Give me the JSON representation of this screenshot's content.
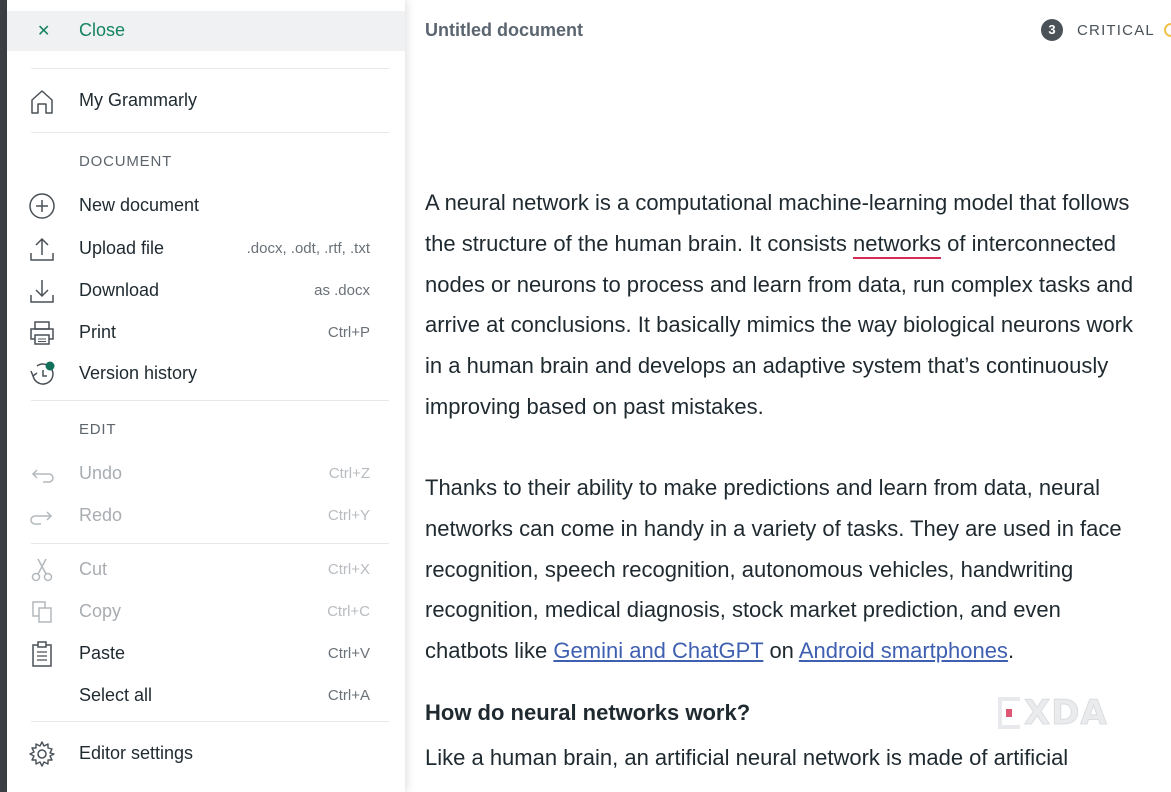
{
  "menu": {
    "close_label": "Close",
    "home_label": "My Grammarly",
    "section_document": "DOCUMENT",
    "document_items": [
      {
        "label": "New document",
        "hint": "",
        "icon": "plus-circle-icon"
      },
      {
        "label": "Upload file",
        "hint": ".docx, .odt, .rtf, .txt",
        "icon": "upload-icon"
      },
      {
        "label": "Download",
        "hint": "as .docx",
        "icon": "download-icon"
      },
      {
        "label": "Print",
        "hint": "Ctrl+P",
        "icon": "printer-icon"
      },
      {
        "label": "Version history",
        "hint": "",
        "icon": "history-icon"
      }
    ],
    "section_edit": "EDIT",
    "edit_items": [
      {
        "label": "Undo",
        "hint": "Ctrl+Z",
        "icon": "undo-icon",
        "disabled": true
      },
      {
        "label": "Redo",
        "hint": "Ctrl+Y",
        "icon": "redo-icon",
        "disabled": true
      },
      {
        "label": "Cut",
        "hint": "Ctrl+X",
        "icon": "scissors-icon",
        "disabled": true
      },
      {
        "label": "Copy",
        "hint": "Ctrl+C",
        "icon": "copy-icon",
        "disabled": true
      },
      {
        "label": "Paste",
        "hint": "Ctrl+V",
        "icon": "clipboard-icon",
        "disabled": false
      },
      {
        "label": "Select all",
        "hint": "Ctrl+A",
        "icon": "",
        "disabled": false
      }
    ],
    "settings_label": "Editor settings"
  },
  "document": {
    "title": "Untitled document",
    "critical_count": "3",
    "critical_label": "CRITICAL",
    "para1": [
      "A neural network is a computational machine-learning model that follows",
      "the structure of the human brain. It consists ",
      "networks",
      " of interconnected",
      "nodes or neurons to process and learn from data, run complex tasks and",
      "arrive at conclusions. It basically mimics the way biological neurons work",
      "in a human brain and develops an adaptive system that’s continuously",
      "improving based on past mistakes."
    ],
    "para2": [
      "Thanks to their ability to make predictions and learn from data, neural",
      "networks can come in handy in a variety of tasks. They are used in face",
      "recognition, speech recognition, autonomous vehicles, handwriting",
      "recognition, medical diagnosis, stock market prediction, and even",
      "chatbots like ",
      "Gemini and ChatGPT",
      " on ",
      "Android smartphones",
      "."
    ],
    "heading": "How do neural networks work?",
    "para3": "Like a human brain, an artificial neural network is made of artificial"
  },
  "watermark": "XDA",
  "colors": {
    "accent_green": "#15845e",
    "error_underline": "#d42c55",
    "link": "#3f5fb0",
    "critical_badge": "#4a5157"
  }
}
